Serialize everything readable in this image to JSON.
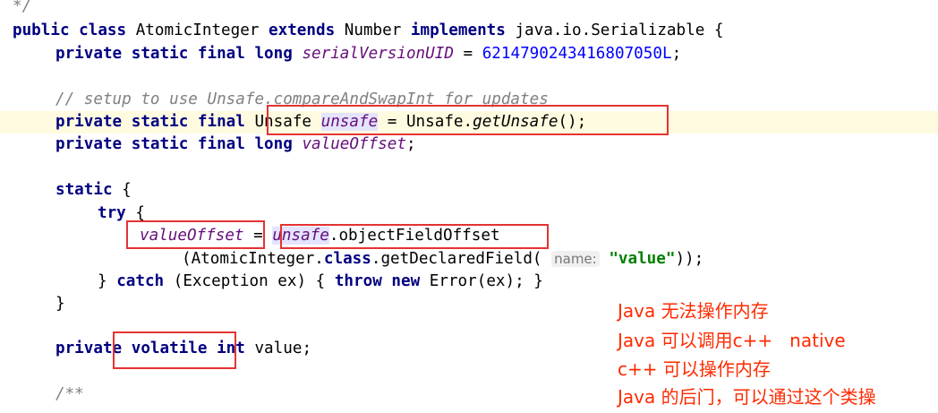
{
  "code": {
    "l0_comment_end": "*/",
    "l1": {
      "kw_public": "public",
      "kw_class": "class",
      "class_name": "AtomicInteger",
      "kw_extends": "extends",
      "parent": "Number",
      "kw_implements": "implements",
      "iface": "java.io.Serializable",
      "brace": "{"
    },
    "l2": {
      "kw_private": "private",
      "kw_static": "static",
      "kw_final": "final",
      "kw_long": "long",
      "field": "serialVersionUID",
      "eq": "=",
      "value": "6214790243416807050L",
      "semi": ";"
    },
    "l3_comment": "// setup to use Unsafe.compareAndSwapInt for updates",
    "l4": {
      "kw_private": "private",
      "kw_static": "static",
      "kw_final": "final",
      "type": "Unsafe",
      "field": "unsafe",
      "eq": "=",
      "call_target": "Unsafe.",
      "method": "getUnsafe",
      "tail": "();"
    },
    "l5": {
      "kw_private": "private",
      "kw_static": "static",
      "kw_final": "final",
      "kw_long": "long",
      "field": "valueOffset",
      "semi": ";"
    },
    "l6": {
      "kw_static": "static",
      "brace": "{"
    },
    "l7": {
      "kw_try": "try",
      "brace": "{"
    },
    "l8": {
      "field": "valueOffset",
      "eq": "=",
      "target": "unsafe",
      "method": ".objectFieldOffset"
    },
    "l9": {
      "pre": "(AtomicInteger.",
      "kw_class": "class",
      "call": ".getDeclaredField(",
      "hint": "name:",
      "str": "\"value\"",
      "tail": "));"
    },
    "l10": {
      "close": "}",
      "kw_catch": "catch",
      "params": "(Exception ex) {",
      "kw_throw": "throw",
      "kw_new": "new",
      "tail": "Error(ex); }"
    },
    "l11_close": "}",
    "l12": {
      "kw_private": "private",
      "kw_volatile": "volatile",
      "kw_int": "int",
      "field": "value",
      "semi": ";"
    },
    "l13_doc": "/**"
  },
  "annotations": [
    "Java 无法操作内存",
    "Java 可以调用c++   native",
    "c++ 可以操作内存",
    "Java 的后门，可以通过这个类操"
  ],
  "colors": {
    "keyword": "#000080",
    "field": "#660e7a",
    "number": "#0000ff",
    "comment": "#808080",
    "string": "#008000",
    "annotation_box": "#e53333",
    "annotation_text": "#ff2a00",
    "current_line": "#fffbe0"
  }
}
